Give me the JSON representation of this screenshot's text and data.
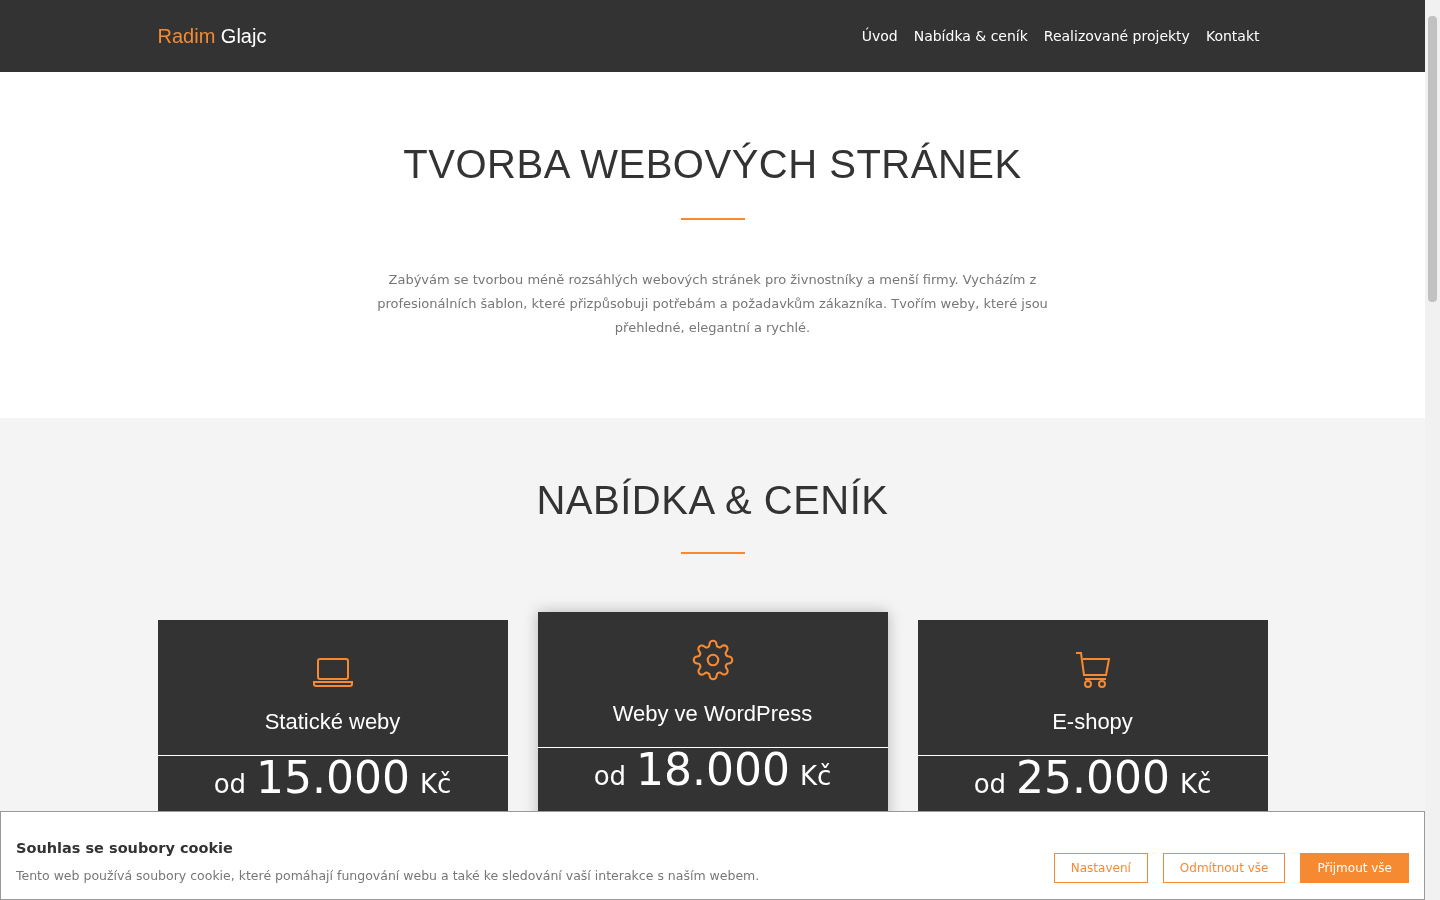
{
  "header": {
    "brand_first": "Radim",
    "brand_second": "Glajc",
    "nav": [
      {
        "label": "Úvod"
      },
      {
        "label": "Nabídka & ceník"
      },
      {
        "label": "Realizované projekty"
      },
      {
        "label": "Kontakt"
      }
    ]
  },
  "hero": {
    "title": "TVORBA WEBOVÝCH STRÁNEK",
    "text": "Zabývám se tvorbou méně rozsáhlých webových stránek pro živnostníky a menší firmy. Vycházím z profesionálních šablon, které přizpůsobuji potřebám a požadavkům zákazníka. Tvořím weby, které jsou přehledné, elegantní a rychlé."
  },
  "offer": {
    "title": "NABÍDKA & CENÍK",
    "cards": [
      {
        "kind": "laptop",
        "title": "Statické weby",
        "prefix": "od",
        "price": "15.000",
        "currency": "Kč",
        "featured": false
      },
      {
        "kind": "gear",
        "title": "Weby ve WordPress",
        "prefix": "od",
        "price": "18.000",
        "currency": "Kč",
        "featured": true
      },
      {
        "kind": "cart",
        "title": "E-shopy",
        "prefix": "od",
        "price": "25.000",
        "currency": "Kč",
        "featured": false
      }
    ]
  },
  "cookie_bar": {
    "title": "Souhlas se soubory cookie",
    "text": "Tento web používá soubory cookie, které pomáhají fungování webu a také ke sledování vaší interakce s naším webem.",
    "buttons": [
      {
        "label": "Nastavení",
        "kind": "outline"
      },
      {
        "label": "Odmítnout vše",
        "kind": "outline"
      },
      {
        "label": "Přijmout vše",
        "kind": "primary"
      }
    ]
  }
}
